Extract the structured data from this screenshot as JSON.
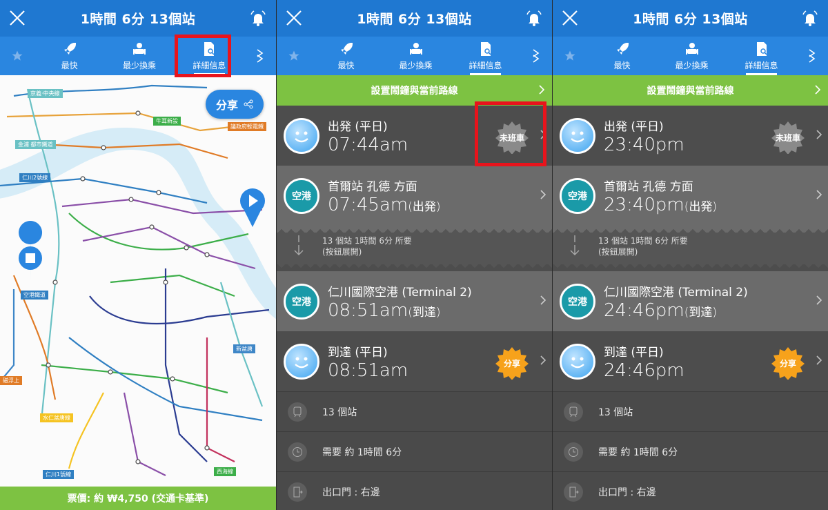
{
  "header": {
    "title": "1時間 6分 13個站"
  },
  "tabs": [
    {
      "label": "最快",
      "icon": "rocket-icon"
    },
    {
      "label": "最少換乘",
      "icon": "seat-icon"
    },
    {
      "label": "詳細信息",
      "icon": "document-search-icon"
    }
  ],
  "map_panel": {
    "share_label": "分享",
    "fare": "票價: 約 ₩4,750 (交通卡基準)",
    "labels": {
      "kyoui": "京義·中央線",
      "airport": "空港鐵道",
      "jinjin": "仁川2號線",
      "gimpo": "金浦 都市鐵道",
      "uijeongbu": "議政府輕電鐵",
      "ui": "牛耳新設",
      "incheon1": "仁川1號線",
      "suin": "水仁盆唐線",
      "sinbundang": "新盆唐",
      "everline": "西海線",
      "eoul": "磁浮上"
    }
  },
  "detail": {
    "banner": "設置鬧鐘與當前路線",
    "depart_title": "出発 (平日)",
    "station_title": "首爾站 孔德 方面",
    "station_badge": "空港",
    "collapsed_line1": "13 個站 1時間 6分 所要",
    "collapsed_line2": "(按鈕展開)",
    "arrive_station_title": "仁川國際空港 (Terminal 2)",
    "arrive_title": "到達 (平日)",
    "suffix_depart": "(出発)",
    "suffix_arrive": "(到達)",
    "last_train": "未班車",
    "share_stamp": "分享",
    "info_stations": "13 個站",
    "info_duration": "需要 約 1時間 6分",
    "info_exit": "出口門 : 右邊"
  },
  "panels": [
    {
      "depart_time": "07:44am",
      "station_time": "07:45am",
      "arrive_station_time": "08:51am",
      "arrive_time": "08:51am"
    },
    {
      "depart_time": "23:40pm",
      "station_time": "23:40pm",
      "arrive_station_time": "24:46pm",
      "arrive_time": "24:46pm"
    }
  ],
  "colors": {
    "header": "#1f78d1",
    "tabs": "#2a86e0",
    "green": "#7dc242",
    "highlight": "#e8141c",
    "airport_badge": "#1a9aa8",
    "share_stamp": "#f7a21b",
    "last_train_stamp": "#8a8a8a"
  }
}
